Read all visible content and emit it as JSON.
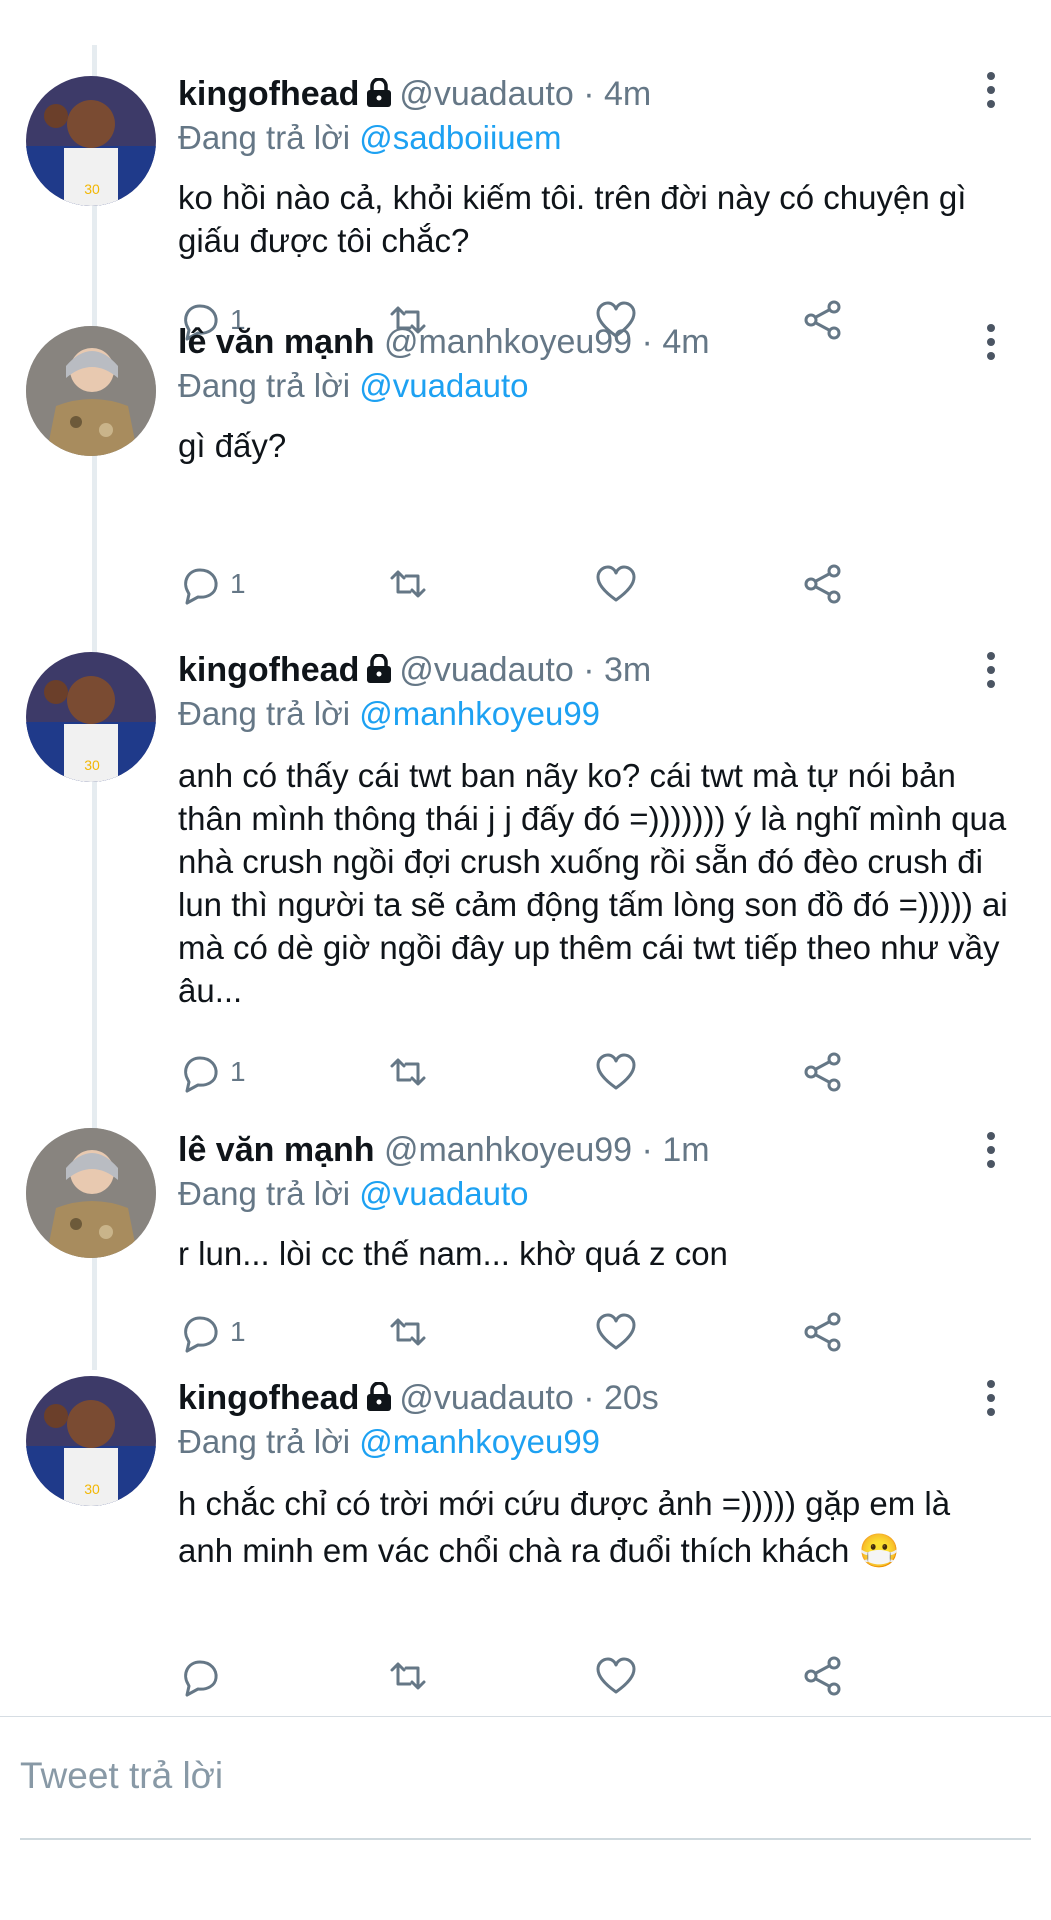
{
  "tweets": [
    {
      "name": "kingofhead",
      "locked": true,
      "handle": "@vuadauto",
      "sep": " · ",
      "time": "4m",
      "replying_prefix": "Đang trả lời ",
      "replying_to": "@sadboiiuem",
      "text": "ko hồi nào cả, khỏi kiếm tôi. trên đời này có chuyện gì giấu được tôi chắc?",
      "reply_count": "1",
      "avatar": "curry"
    },
    {
      "name": "lê văn mạnh",
      "locked": false,
      "handle": "@manhkoyeu99",
      "sep": " · ",
      "time": "4m",
      "replying_prefix": "Đang trả lời ",
      "replying_to": "@vuadauto",
      "text": "gì đấy?",
      "reply_count": "1",
      "avatar": "manh"
    },
    {
      "name": "kingofhead",
      "locked": true,
      "handle": "@vuadauto",
      "sep": " · ",
      "time": "3m",
      "replying_prefix": "Đang trả lời ",
      "replying_to": "@manhkoyeu99",
      "text": "anh có thấy cái twt ban nãy ko? cái twt mà tự nói bản thân mình thông thái j j đấy đó =))))))) ý là nghĩ mình qua nhà crush ngồi đợi crush xuống rồi sẵn đó đèo crush đi lun thì người ta sẽ cảm động tấm lòng son đồ đó =))))) ai mà có dè giờ ngồi đây up thêm cái twt tiếp theo như vầy âu...",
      "reply_count": "1",
      "avatar": "curry"
    },
    {
      "name": "lê văn mạnh",
      "locked": false,
      "handle": "@manhkoyeu99",
      "sep": " · ",
      "time": "1m",
      "replying_prefix": "Đang trả lời ",
      "replying_to": "@vuadauto",
      "text": "r lun... lòi cc thế nam... khờ quá z con",
      "reply_count": "1",
      "avatar": "manh"
    },
    {
      "name": "kingofhead",
      "locked": true,
      "handle": "@vuadauto",
      "sep": " · ",
      "time": "20s",
      "replying_prefix": "Đang trả lời ",
      "replying_to": "@manhkoyeu99",
      "text": "h chắc chỉ có trời mới cứu được ảnh =))))) gặp em là anh minh em vác chổi chà ra đuổi thích khách 😷",
      "reply_count": "",
      "avatar": "curry"
    }
  ],
  "reply_box": {
    "placeholder": "Tweet trả lời"
  },
  "colors": {
    "link": "#1da1f2",
    "secondary": "#657786",
    "text": "#0f1419"
  }
}
